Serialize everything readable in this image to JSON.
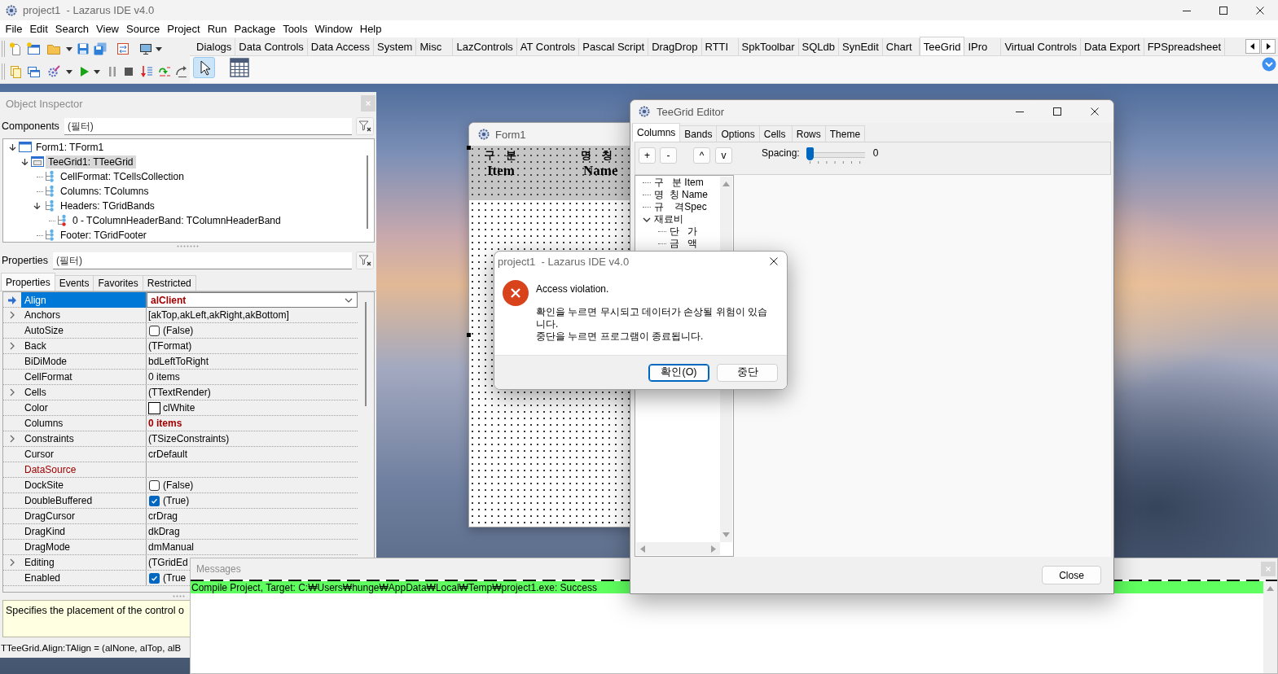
{
  "window": {
    "title": "project1  - Lazarus IDE v4.0"
  },
  "menu": [
    "File",
    "Edit",
    "Search",
    "View",
    "Source",
    "Project",
    "Run",
    "Package",
    "Tools",
    "Window",
    "Help"
  ],
  "palette": {
    "tabs": [
      {
        "label": "Dialogs",
        "selected": false
      },
      {
        "label": "Data Controls",
        "selected": false
      },
      {
        "label": "Data Access",
        "selected": false
      },
      {
        "label": "System",
        "selected": false
      },
      {
        "label": "Misc",
        "selected": false
      },
      {
        "label": "LazControls",
        "selected": false
      },
      {
        "label": "AT Controls",
        "selected": false
      },
      {
        "label": "Pascal Script",
        "selected": false
      },
      {
        "label": "DragDrop",
        "selected": false
      },
      {
        "label": "RTTI",
        "selected": false
      },
      {
        "label": "SpkToolbar",
        "selected": false
      },
      {
        "label": "SQLdb",
        "selected": false
      },
      {
        "label": "SynEdit",
        "selected": false
      },
      {
        "label": "Chart",
        "selected": false
      },
      {
        "label": "TeeGrid",
        "selected": true
      },
      {
        "label": "IPro",
        "selected": false
      },
      {
        "label": "Virtual Controls",
        "selected": false
      },
      {
        "label": "Data Export",
        "selected": false
      },
      {
        "label": "FPSpreadsheet",
        "selected": false
      }
    ],
    "components": [
      {
        "kind": "pointer",
        "selected": true
      },
      {
        "kind": "grid",
        "selected": false
      }
    ]
  },
  "object_inspector": {
    "title": "Object Inspector",
    "components_label": "Components",
    "components_filter": {
      "placeholder": "(필터)"
    },
    "tree": [
      {
        "label": "Form1: TForm1",
        "kind": "form",
        "expanded": true,
        "selected": false,
        "children": [
          {
            "label": "TeeGrid1: TTeeGrid",
            "kind": "component",
            "expanded": true,
            "selected": true,
            "children": [
              {
                "label": "CellFormat: TCellsCollection",
                "kind": "collection",
                "expanded": false,
                "selected": false
              },
              {
                "label": "Columns: TColumns",
                "kind": "collection",
                "expanded": false,
                "selected": false
              },
              {
                "label": "Headers: TGridBands",
                "kind": "collection",
                "expanded": true,
                "selected": false,
                "children": [
                  {
                    "label": "0 - TColumnHeaderBand: TColumnHeaderBand",
                    "kind": "item",
                    "expanded": false,
                    "selected": false
                  }
                ]
              },
              {
                "label": "Footer: TGridFooter",
                "kind": "collection",
                "expanded": false,
                "selected": false
              }
            ]
          }
        ]
      }
    ],
    "properties_label": "Properties",
    "properties_filter": {
      "placeholder": "(필터)"
    },
    "tabs": [
      {
        "label": "Properties",
        "selected": true
      },
      {
        "label": "Events",
        "selected": false
      },
      {
        "label": "Favorites",
        "selected": false
      },
      {
        "label": "Restricted",
        "selected": false
      }
    ],
    "properties": [
      {
        "name": "Align",
        "value": "alClient",
        "kind": "dropdown",
        "selected": true,
        "expandable": false,
        "modified": true,
        "highlighted": false
      },
      {
        "name": "Anchors",
        "value": "[akTop,akLeft,akRight,akBottom]",
        "kind": "text",
        "selected": false,
        "expandable": true,
        "modified": false,
        "highlighted": false
      },
      {
        "name": "AutoSize",
        "value": "(False)",
        "kind": "check",
        "checked": false,
        "selected": false,
        "expandable": false,
        "modified": false,
        "highlighted": false
      },
      {
        "name": "Back",
        "value": "(TFormat)",
        "kind": "text",
        "selected": false,
        "expandable": true,
        "modified": false,
        "highlighted": false
      },
      {
        "name": "BiDiMode",
        "value": "bdLeftToRight",
        "kind": "text",
        "selected": false,
        "expandable": false,
        "modified": false,
        "highlighted": false
      },
      {
        "name": "CellFormat",
        "value": "0 items",
        "kind": "text",
        "selected": false,
        "expandable": false,
        "modified": false,
        "highlighted": false
      },
      {
        "name": "Cells",
        "value": "(TTextRender)",
        "kind": "text",
        "selected": false,
        "expandable": true,
        "modified": false,
        "highlighted": false
      },
      {
        "name": "Color",
        "value": "clWhite",
        "kind": "color",
        "color": "#ffffff",
        "selected": false,
        "expandable": false,
        "modified": false,
        "highlighted": false
      },
      {
        "name": "Columns",
        "value": "0 items",
        "kind": "text",
        "selected": false,
        "expandable": false,
        "modified": true,
        "highlighted": false
      },
      {
        "name": "Constraints",
        "value": "(TSizeConstraints)",
        "kind": "text",
        "selected": false,
        "expandable": true,
        "modified": false,
        "highlighted": false
      },
      {
        "name": "Cursor",
        "value": "crDefault",
        "kind": "text",
        "selected": false,
        "expandable": false,
        "modified": false,
        "highlighted": false
      },
      {
        "name": "DataSource",
        "kind": "text",
        "selected": false,
        "expandable": false,
        "highlighted": true
      },
      {
        "name": "DockSite",
        "value": "(False)",
        "kind": "check",
        "checked": false,
        "selected": false,
        "expandable": false,
        "modified": false,
        "highlighted": false
      },
      {
        "name": "DoubleBuffered",
        "value": "(True)",
        "kind": "check",
        "checked": true,
        "selected": false,
        "expandable": false,
        "modified": false,
        "highlighted": false
      },
      {
        "name": "DragCursor",
        "value": "crDrag",
        "kind": "text",
        "selected": false,
        "expandable": false,
        "modified": false,
        "highlighted": false
      },
      {
        "name": "DragKind",
        "value": "dkDrag",
        "kind": "text",
        "selected": false,
        "expandable": false,
        "modified": false,
        "highlighted": false
      },
      {
        "name": "DragMode",
        "value": "dmManual",
        "kind": "text",
        "selected": false,
        "expandable": false,
        "modified": false,
        "highlighted": false
      },
      {
        "name": "Editing",
        "value": "(TGridEd",
        "kind": "text",
        "selected": false,
        "expandable": true,
        "modified": false,
        "highlighted": false
      },
      {
        "name": "Enabled",
        "value": "(True",
        "kind": "check",
        "checked": true,
        "selected": false,
        "expandable": false,
        "modified": false,
        "highlighted": false
      }
    ],
    "hint": "Specifies the placement of the control o",
    "status": "TTeeGrid.Align:TAlign = (alNone, alTop, alB"
  },
  "form": {
    "title": "Form1",
    "columns": [
      {
        "label": "구    분",
        "caption": "Item"
      },
      {
        "label": "명    칭",
        "caption": "Name"
      }
    ]
  },
  "grid_editor": {
    "title": "TeeGrid Editor",
    "tabs": [
      {
        "label": "Columns",
        "selected": true
      },
      {
        "label": "Bands",
        "selected": false
      },
      {
        "label": "Options",
        "selected": false
      },
      {
        "label": "Cells",
        "selected": false
      },
      {
        "label": "Rows",
        "selected": false
      },
      {
        "label": "Theme",
        "selected": false
      }
    ],
    "buttons": [
      "+",
      "-",
      "^",
      "v"
    ],
    "spacing_label": "Spacing:",
    "spacing": {
      "level": 0
    },
    "spacing_value": "0",
    "tree": [
      {
        "label": "구   분 Item",
        "expanded": false
      },
      {
        "label": "명  칭 Name",
        "expanded": false
      },
      {
        "label": "규    격Spec",
        "expanded": false
      },
      {
        "label": "재료비",
        "expanded": true,
        "children": [
          {
            "label": "단   가",
            "expanded": false
          },
          {
            "label": "금   액",
            "expanded": false
          }
        ]
      }
    ],
    "close_button": "Close"
  },
  "dialog": {
    "title": "project1  - Lazarus IDE v4.0",
    "message": "Access violation.",
    "details": [
      "확인을 누르면 무시되고 데이터가 손상될 위험이 있습니다.",
      "중단을 누르면 프로그램이 종료됩니다."
    ],
    "buttons": [
      {
        "label": "확인(O)",
        "default": true
      },
      {
        "label": "중단",
        "default": false
      }
    ]
  },
  "messages": {
    "title": "Messages",
    "lines": [
      {
        "text": "Compile Project, Target: C:₩Users₩hunge₩AppData₩Local₩Temp₩project1.exe: Success",
        "kind": "success"
      }
    ]
  }
}
